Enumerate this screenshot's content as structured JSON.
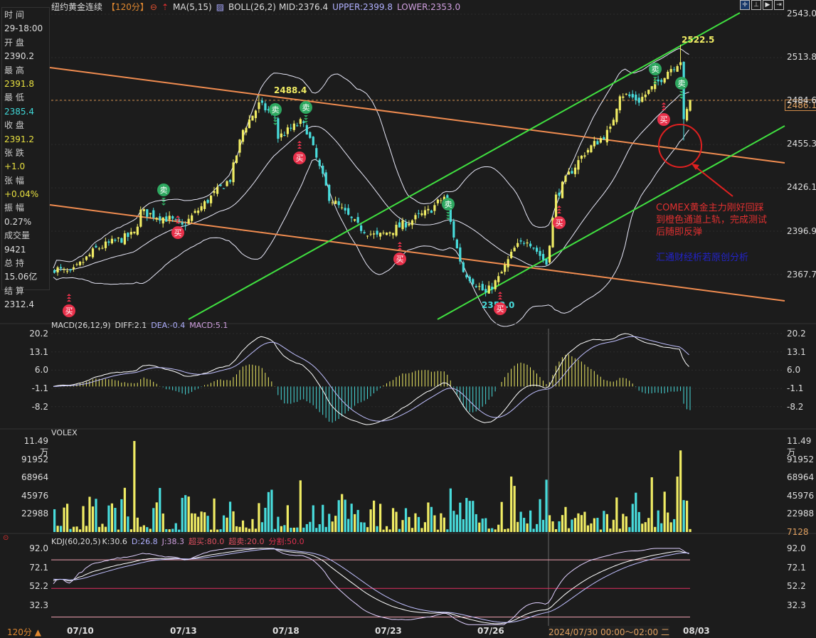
{
  "header": {
    "title": "纽约黄金连续",
    "period": "【120分】",
    "ma": "MA(5,15)",
    "boll": "BOLL(26,2)",
    "mid": "MID:2376.4",
    "upper": "UPPER:2399.8",
    "lower": "LOWER:2353.0"
  },
  "sidebar": [
    {
      "label": "时 间",
      "value": "29-18:00",
      "color": "#dddddd"
    },
    {
      "label": "开 盘",
      "value": "2390.2",
      "color": "#dddddd"
    },
    {
      "label": "最 高",
      "value": "2391.8",
      "color": "#e8e040"
    },
    {
      "label": "最 低",
      "value": "2385.4",
      "color": "#40d8d8"
    },
    {
      "label": "收 盘",
      "value": "2391.2",
      "color": "#e8e040"
    },
    {
      "label": "张 跌",
      "value": "+1.0",
      "color": "#e8e040"
    },
    {
      "label": "张 幅",
      "value": "+0.04%",
      "color": "#e8e040"
    },
    {
      "label": "振 幅",
      "value": "0.27%",
      "color": "#dddddd"
    },
    {
      "label": "成交量",
      "value": "9421",
      "color": "#dddddd"
    },
    {
      "label": "总 持",
      "value": "15.06亿",
      "color": "#dddddd"
    },
    {
      "label": "结 算",
      "value": "2312.4",
      "color": "#dddddd"
    }
  ],
  "price_axis": [
    "2543.0",
    "2513.8",
    "2484.6",
    "2455.3",
    "2426.1",
    "2396.9",
    "2367.7"
  ],
  "current_price": "2486.1",
  "labels": {
    "high1": "2488.4",
    "high2": "2522.5",
    "low1": "2353.0"
  },
  "signals": {
    "buy": "买",
    "sell": "卖"
  },
  "annotation": {
    "lines": [
      "COMEX黄金主力刚好回踩",
      "到橙色通道上轨，完成测试",
      "后随即反弹"
    ],
    "author": "汇通财经析若原创分析"
  },
  "macd": {
    "title": "MACD(26,12,9)",
    "diff": "DIFF:2.1",
    "dea": "DEA:-0.4",
    "macd": "MACD:5.1",
    "axis": [
      "20.2",
      "13.1",
      "6.0",
      "-1.1",
      "-8.2"
    ]
  },
  "volex": {
    "title": "VOLEX",
    "axis": [
      "11.49万",
      "91952",
      "68964",
      "45976",
      "22988"
    ],
    "current": "7128"
  },
  "kdj": {
    "title": "KDJ(60,20,5)",
    "k": "K:30.6",
    "d": "D:26.8",
    "j": "J:38.3",
    "ob": "超买:80.0",
    "os": "超卖:20.0",
    "split": "分割:50.0",
    "axis": [
      "92.0",
      "72.1",
      "52.2",
      "32.3"
    ]
  },
  "dates": [
    "07/10",
    "07/13",
    "07/18",
    "07/23",
    "07/26",
    "08/03"
  ],
  "cursor_time": "2024/07/30 00:00～02:00 二",
  "period_button": "120分 ▲",
  "colors": {
    "up": "#f0ec64",
    "down": "#48dcdc",
    "channel_orange": "#f08c50",
    "channel_green": "#40e040",
    "buy": "#e8304a",
    "sell": "#2ea860"
  },
  "chart_data": {
    "type": "candlestick",
    "title": "纽约黄金连续 120分",
    "ylim": [
      2340,
      2545
    ],
    "close_path": [
      [
        0,
        2372
      ],
      [
        5,
        2368
      ],
      [
        13,
        2385
      ],
      [
        25,
        2395
      ],
      [
        27,
        2410
      ],
      [
        36,
        2405
      ],
      [
        40,
        2400
      ],
      [
        49,
        2420
      ],
      [
        55,
        2432
      ],
      [
        59,
        2465
      ],
      [
        64,
        2482
      ],
      [
        69,
        2475
      ],
      [
        70,
        2460
      ],
      [
        77,
        2470
      ],
      [
        79,
        2465
      ],
      [
        86,
        2420
      ],
      [
        95,
        2400
      ],
      [
        101,
        2393
      ],
      [
        108,
        2400
      ],
      [
        117,
        2410
      ],
      [
        122,
        2420
      ],
      [
        126,
        2385
      ],
      [
        128,
        2370
      ],
      [
        135,
        2355
      ],
      [
        139,
        2365
      ],
      [
        144,
        2385
      ],
      [
        148,
        2392
      ],
      [
        154,
        2375
      ],
      [
        157,
        2420
      ],
      [
        161,
        2435
      ],
      [
        166,
        2450
      ],
      [
        174,
        2465
      ],
      [
        177,
        2490
      ],
      [
        183,
        2485
      ],
      [
        188,
        2495
      ],
      [
        192,
        2505
      ],
      [
        196,
        2512
      ],
      [
        197,
        2470
      ],
      [
        199,
        2486
      ]
    ]
  }
}
